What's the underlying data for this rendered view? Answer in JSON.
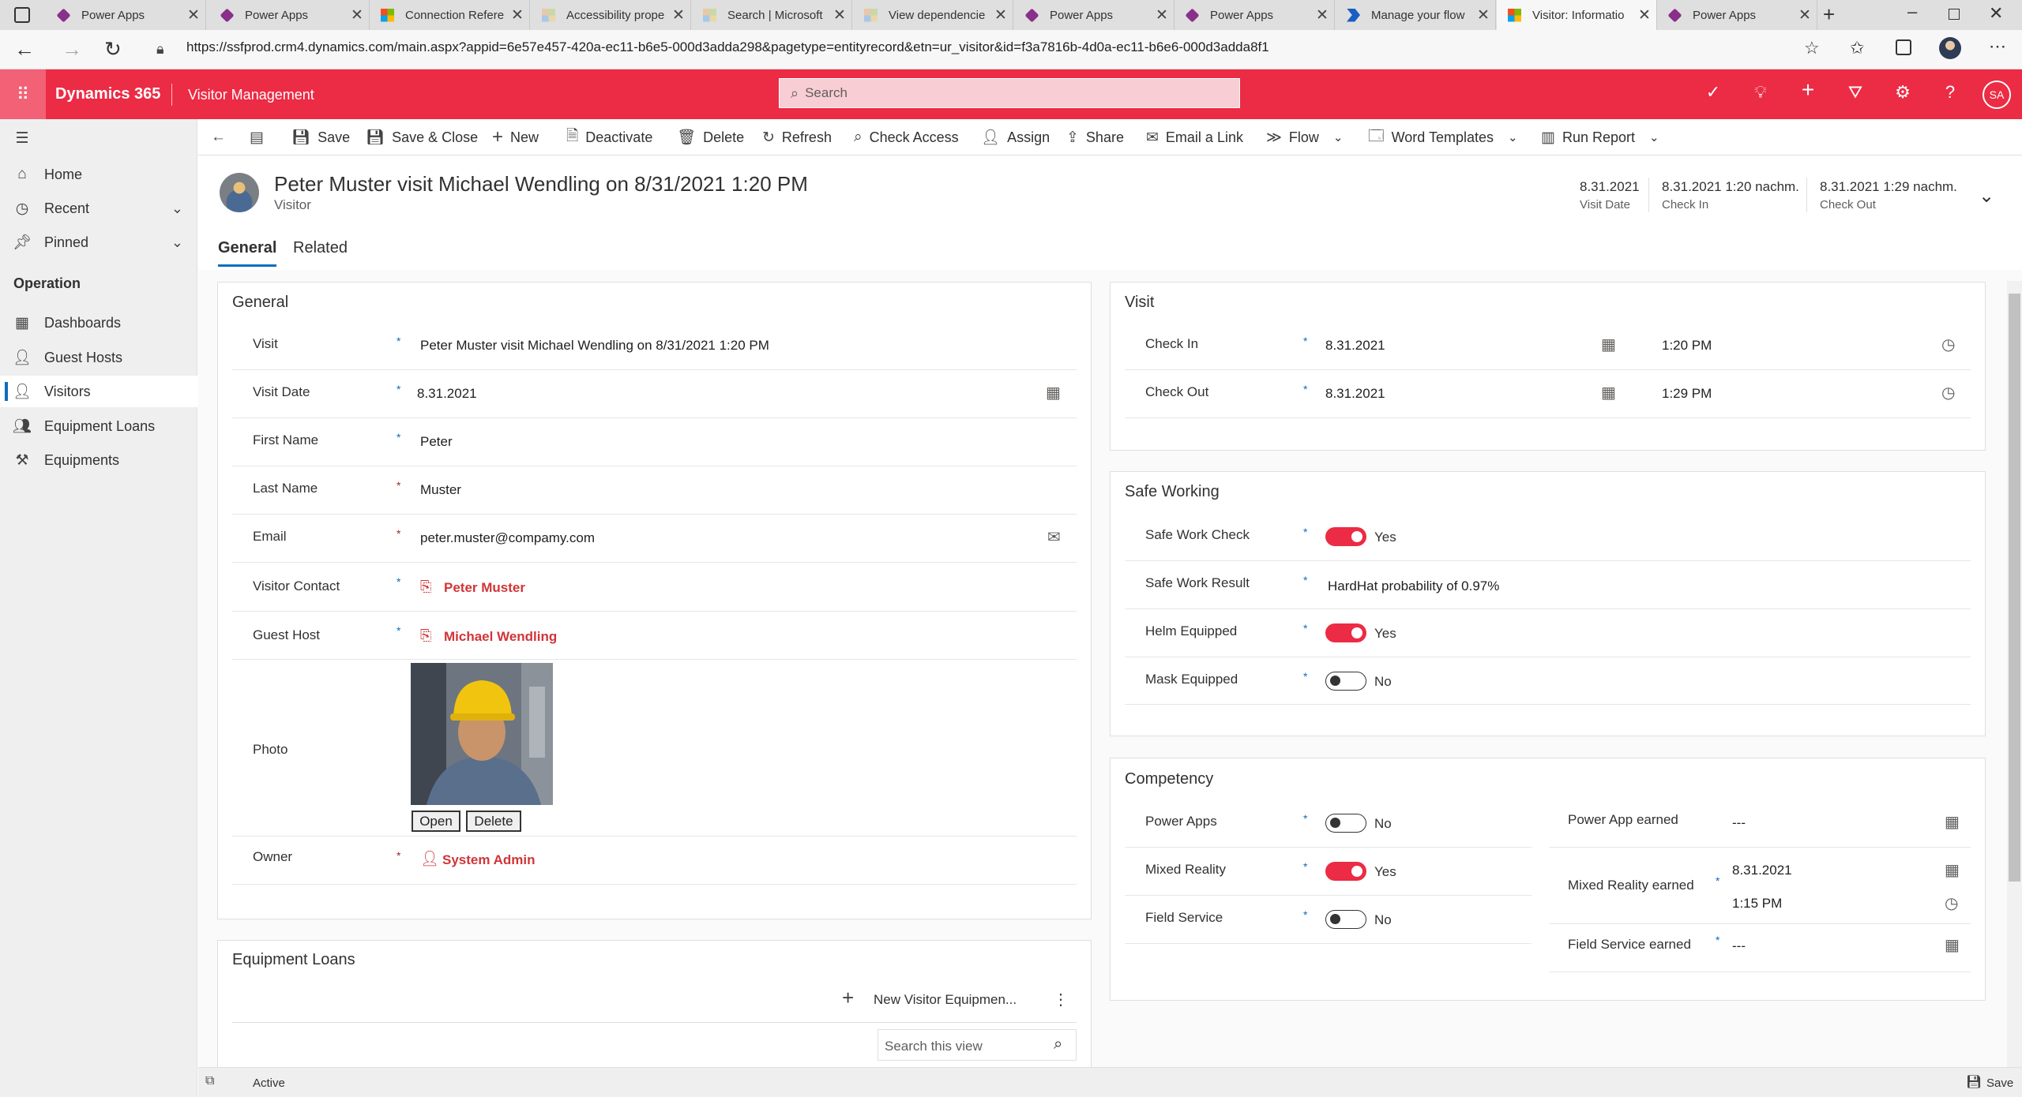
{
  "browser": {
    "tabs": [
      {
        "title": "Power Apps",
        "favicon": "power-apps-icon"
      },
      {
        "title": "Power Apps",
        "favicon": "power-apps-icon"
      },
      {
        "title": "Connection Refere",
        "favicon": "microsoft-icon"
      },
      {
        "title": "Accessibility prope",
        "favicon": "docs-icon"
      },
      {
        "title": "Search | Microsoft",
        "favicon": "docs-icon"
      },
      {
        "title": "View dependencie",
        "favicon": "docs-icon"
      },
      {
        "title": "Power Apps",
        "favicon": "power-apps-icon"
      },
      {
        "title": "Power Apps",
        "favicon": "power-apps-icon"
      },
      {
        "title": "Manage your flow",
        "favicon": "power-automate-icon"
      },
      {
        "title": "Visitor: Informatio",
        "favicon": "microsoft-icon"
      },
      {
        "title": "Power Apps",
        "favicon": "power-apps-icon"
      }
    ],
    "active_tab_index": 9,
    "url": "https://ssfprod.crm4.dynamics.com/main.aspx?appid=6e57e457-420a-ec11-b6e5-000d3adda298&pagetype=entityrecord&etn=ur_visitor&id=f3a7816b-4d0a-ec11-b6e6-000d3adda8f1"
  },
  "app": {
    "brand": "Dynamics 365",
    "name": "Visitor Management",
    "search_placeholder": "Search",
    "user_initials": "SA",
    "accent_color": "#ec2b44"
  },
  "nav": {
    "home": "Home",
    "recent": "Recent",
    "pinned": "Pinned",
    "section": "Operation",
    "items": [
      "Dashboards",
      "Guest Hosts",
      "Visitors",
      "Equipment Loans",
      "Equipments"
    ],
    "selected": "Visitors"
  },
  "commands": {
    "save": "Save",
    "save_close": "Save & Close",
    "new": "New",
    "deactivate": "Deactivate",
    "delete": "Delete",
    "refresh": "Refresh",
    "check_access": "Check Access",
    "assign": "Assign",
    "share": "Share",
    "email_link": "Email a Link",
    "flow": "Flow",
    "word_templates": "Word Templates",
    "run_report": "Run Report"
  },
  "record": {
    "title": "Peter Muster visit Michael Wendling on 8/31/2021 1:20 PM",
    "entity": "Visitor",
    "header_fields": [
      {
        "value": "8.31.2021",
        "label": "Visit Date"
      },
      {
        "value": "8.31.2021 1:20 nachm.",
        "label": "Check In"
      },
      {
        "value": "8.31.2021 1:29 nachm.",
        "label": "Check Out"
      }
    ],
    "tabs": [
      "General",
      "Related"
    ]
  },
  "general": {
    "title": "General",
    "visit_label": "Visit",
    "visit_value": "Peter Muster visit Michael Wendling on 8/31/2021 1:20 PM",
    "visit_date_label": "Visit Date",
    "visit_date_value": "8.31.2021",
    "first_name_label": "First Name",
    "first_name_value": "Peter",
    "last_name_label": "Last Name",
    "last_name_value": "Muster",
    "email_label": "Email",
    "email_value": "peter.muster@compamy.com",
    "visitor_contact_label": "Visitor Contact",
    "visitor_contact_value": "Peter Muster",
    "guest_host_label": "Guest Host",
    "guest_host_value": "Michael Wendling",
    "photo_label": "Photo",
    "photo_open": "Open",
    "photo_delete": "Delete",
    "owner_label": "Owner",
    "owner_value": "System Admin"
  },
  "equipment": {
    "title": "Equipment Loans",
    "new_label": "New Visitor Equipmen...",
    "search_placeholder": "Search this view"
  },
  "visit": {
    "title": "Visit",
    "check_in_label": "Check In",
    "check_in_date": "8.31.2021",
    "check_in_time": "1:20 PM",
    "check_out_label": "Check Out",
    "check_out_date": "8.31.2021",
    "check_out_time": "1:29 PM"
  },
  "safe": {
    "title": "Safe Working",
    "check_label": "Safe Work Check",
    "check_value": "Yes",
    "result_label": "Safe Work Result",
    "result_value": "HardHat probability of 0.97%",
    "helm_label": "Helm Equipped",
    "helm_value": "Yes",
    "mask_label": "Mask Equipped",
    "mask_value": "No"
  },
  "competency": {
    "title": "Competency",
    "power_apps_label": "Power Apps",
    "power_apps_value": "No",
    "mixed_reality_label": "Mixed Reality",
    "mixed_reality_value": "Yes",
    "field_service_label": "Field Service",
    "field_service_value": "No",
    "pa_earned_label": "Power App earned",
    "pa_earned_value": "---",
    "mr_earned_label": "Mixed Reality earned",
    "mr_earned_date": "8.31.2021",
    "mr_earned_time": "1:15 PM",
    "fs_earned_label": "Field Service earned",
    "fs_earned_value": "---"
  },
  "status": {
    "state": "Active",
    "save": "Save"
  }
}
